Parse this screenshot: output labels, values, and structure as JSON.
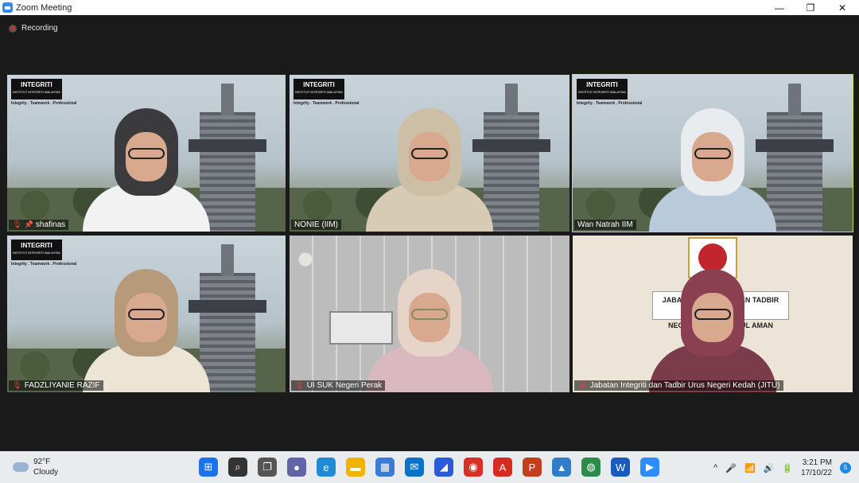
{
  "window": {
    "title": "Zoom Meeting",
    "minimize_icon": "—",
    "restore_icon": "❐",
    "close_icon": "✕"
  },
  "meeting": {
    "recording_label": "Recording",
    "logo_title": "INTEGRITI",
    "logo_subtitle": "INSTITUT INTEGRITI MALAYSIA",
    "tagline": "Integrity . Teamwork . Professional",
    "participants": [
      {
        "name": "shafinas",
        "muted": true,
        "pinned": true
      },
      {
        "name": "NONIE (IIM)",
        "muted": false
      },
      {
        "name": "Wan Natrah IIM",
        "muted": false,
        "active_speaker": true
      },
      {
        "name": "FADZLIYANIE RAZIF",
        "muted": true
      },
      {
        "name": "UI SUK Negeri Perak",
        "muted": true
      },
      {
        "name": "Jabatan Integriti dan Tadbir Urus Negeri Kedah (JITU)",
        "muted": true
      }
    ],
    "office_sign_line1": "JABATAN INTEGRITI DAN TADBIR URUS",
    "office_sign_line2": "NEGERI KEDAH DARUL AMAN"
  },
  "taskbar": {
    "weather_temp": "92°F",
    "weather_desc": "Cloudy",
    "time": "3:21 PM",
    "date": "17/10/22",
    "notification_badge": "5",
    "apps": [
      {
        "name": "start",
        "glyph": "⊞",
        "color": "#1a73e8"
      },
      {
        "name": "search",
        "glyph": "⌕",
        "color": "#333333"
      },
      {
        "name": "task-view",
        "glyph": "❐",
        "color": "#555555"
      },
      {
        "name": "teams-chat",
        "glyph": "●",
        "color": "#6264a7"
      },
      {
        "name": "edge",
        "glyph": "e",
        "color": "#1e8bd4"
      },
      {
        "name": "file-explorer",
        "glyph": "▬",
        "color": "#f0b400"
      },
      {
        "name": "store",
        "glyph": "▦",
        "color": "#3a7bd5"
      },
      {
        "name": "mail",
        "glyph": "✉",
        "color": "#0a72c9"
      },
      {
        "name": "app-blue",
        "glyph": "◢",
        "color": "#2a5bd8"
      },
      {
        "name": "chrome",
        "glyph": "◉",
        "color": "#d93025"
      },
      {
        "name": "acrobat",
        "glyph": "A",
        "color": "#d62b1f"
      },
      {
        "name": "powerpoint",
        "glyph": "P",
        "color": "#c43e1c"
      },
      {
        "name": "photos",
        "glyph": "▲",
        "color": "#2f7dc9"
      },
      {
        "name": "globe-app",
        "glyph": "◍",
        "color": "#2c8a4a"
      },
      {
        "name": "word",
        "glyph": "W",
        "color": "#185abd"
      },
      {
        "name": "zoom",
        "glyph": "▶",
        "color": "#2D8CFF"
      }
    ],
    "tray_icons": [
      "^",
      "🎤",
      "📶",
      "🔊",
      "🔋"
    ]
  }
}
